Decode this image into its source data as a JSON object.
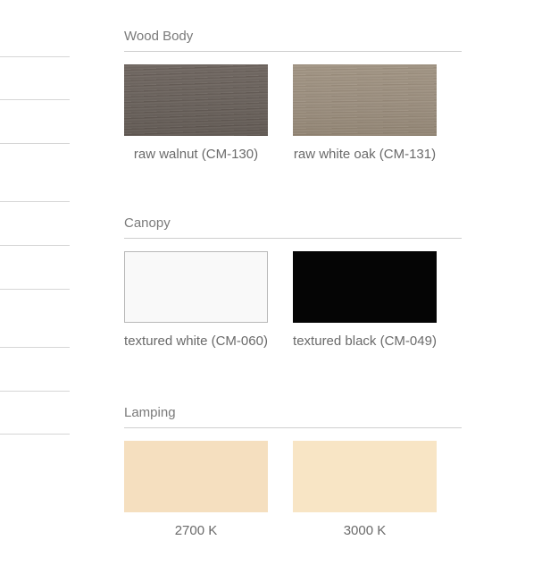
{
  "sections": [
    {
      "title": "Wood Body",
      "swatches": [
        {
          "label": "raw walnut (CM-130)",
          "color": "#6f6761",
          "texture": "walnut"
        },
        {
          "label": "raw white oak (CM-131)",
          "color": "#9e9181",
          "texture": "oak"
        }
      ]
    },
    {
      "title": "Canopy",
      "swatches": [
        {
          "label": "textured white (CM-060)",
          "color": "#f9f9f9",
          "border": "#b8b8b8"
        },
        {
          "label": "textured black (CM-049)",
          "color": "#050505"
        }
      ]
    },
    {
      "title": "Lamping",
      "swatches": [
        {
          "label": "2700 K",
          "color": "#f5dfbf"
        },
        {
          "label": "3000 K",
          "color": "#f8e5c5"
        }
      ]
    }
  ]
}
